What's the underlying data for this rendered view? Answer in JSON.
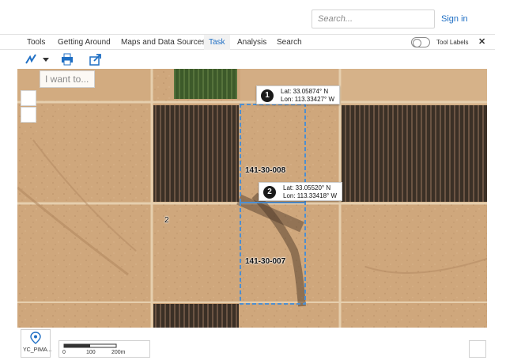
{
  "header": {
    "search_placeholder": "Search...",
    "sign_in": "Sign in"
  },
  "tabs": [
    {
      "label": "Tools"
    },
    {
      "label": "Getting Around"
    },
    {
      "label": "Maps and Data Sources"
    },
    {
      "label": "Task"
    },
    {
      "label": "Analysis"
    },
    {
      "label": "Search"
    }
  ],
  "active_tab": "Task",
  "tool_labels": "Tool Labels",
  "close_glyph": "✕",
  "toolbar_icons": [
    "draw-line-icon",
    "dropdown-icon",
    "print-icon",
    "share-icon"
  ],
  "map": {
    "i_want_to": "I want to...",
    "markers": [
      {
        "num": "1",
        "lat": "Lat: 33.05874° N",
        "lon": "Lon: 113.33427° W"
      },
      {
        "num": "2",
        "lat": "Lat: 33.05520° N",
        "lon": "Lon: 113.33418° W"
      }
    ],
    "parcels": [
      "141-30-008",
      "141-30-007"
    ],
    "small_label": "2"
  },
  "footer": {
    "basemap_label": "YC_PIMA...",
    "scale": [
      "0",
      "100",
      "200m"
    ]
  },
  "colors": {
    "accent": "#1f6fc4",
    "parcel_outline": "#4d8fd1",
    "desert": "#cfa77c",
    "field": "#3a2e24",
    "green_field": "#3d5a2a"
  }
}
